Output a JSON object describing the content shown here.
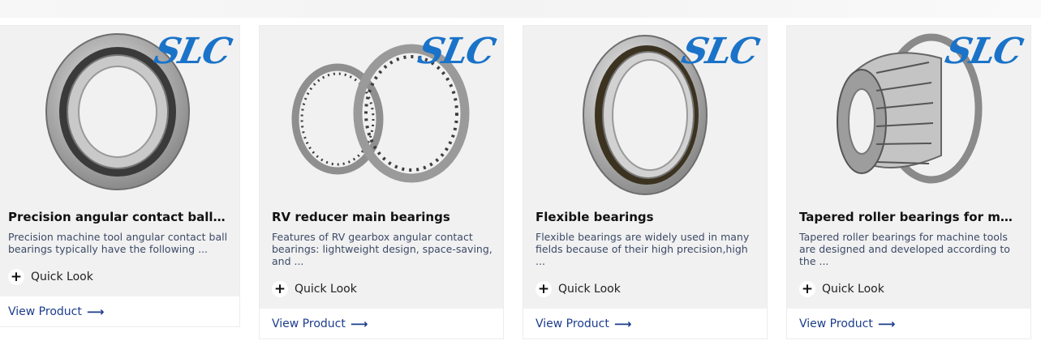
{
  "products": [
    {
      "logo": "SLC",
      "title": "Precision angular contact ball bearings",
      "desc": "Precision machine tool angular contact ball bearings typically have the following ...",
      "quick_look": "Quick Look",
      "view_product": "View Product"
    },
    {
      "logo": "SLC",
      "title": "RV reducer main bearings",
      "desc": "Features of RV gearbox angular contact bearings: lightweight design, space-saving, and ...",
      "quick_look": "Quick Look",
      "view_product": "View Product"
    },
    {
      "logo": "SLC",
      "title": "Flexible bearings",
      "desc": "Flexible bearings are widely used in many fields because of their high precision,high ...",
      "quick_look": "Quick Look",
      "view_product": "View Product"
    },
    {
      "logo": "SLC",
      "title": "Tapered roller bearings for machine tools",
      "desc": "Tapered roller bearings for machine tools are designed and developed according to the ...",
      "quick_look": "Quick Look",
      "view_product": "View Product"
    }
  ],
  "icons": {
    "plus": "plus-icon",
    "arrow": "arrow-right-icon"
  },
  "colors": {
    "logo": "#1a73c8",
    "link": "#1b3d8c",
    "card_bg": "#f1f1f1"
  }
}
